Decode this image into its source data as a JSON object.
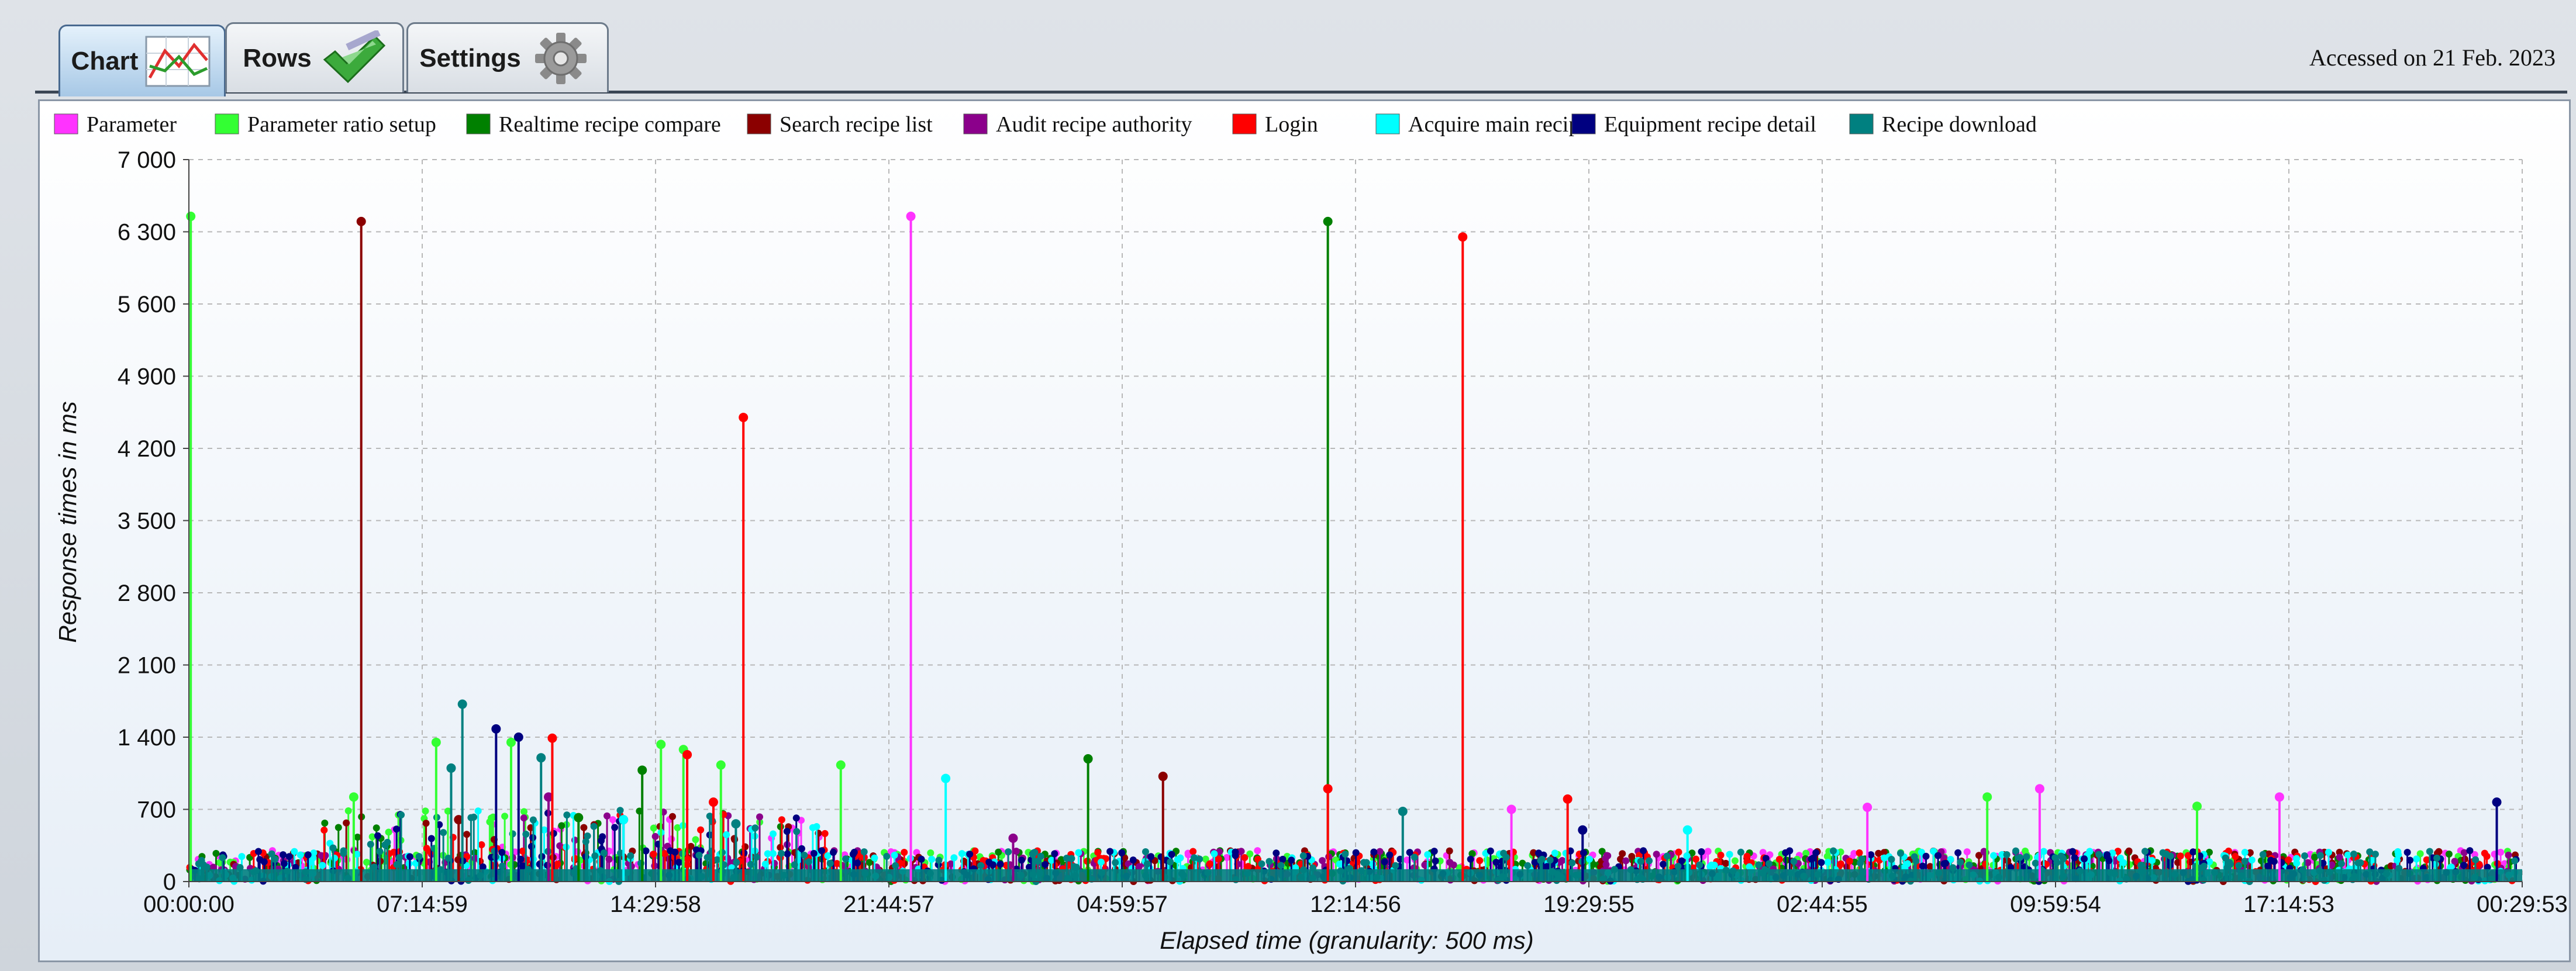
{
  "tabs": [
    {
      "label": "Chart",
      "icon": "line-chart-icon",
      "active": true
    },
    {
      "label": "Rows",
      "icon": "checkmark-icon",
      "active": false
    },
    {
      "label": "Settings",
      "icon": "gear-icon",
      "active": false
    }
  ],
  "accessed_note": "Accessed on 21 Feb. 2023",
  "chart_data": {
    "type": "line",
    "style": "spike/stem plot with point markers",
    "xlabel": "Elapsed time (granularity: 500 ms)",
    "ylabel": "Response times in ms",
    "ylim": [
      0,
      7000
    ],
    "yticks": [
      0,
      700,
      1400,
      2100,
      2800,
      3500,
      4200,
      4900,
      5600,
      6300,
      7000
    ],
    "ytick_labels": [
      "0",
      "700",
      "1 400",
      "2 100",
      "2 800",
      "3 500",
      "4 200",
      "4 900",
      "5 600",
      "6 300",
      "7 000"
    ],
    "xticks": [
      "00:00:00",
      "07:14:59",
      "14:29:58",
      "21:44:57",
      "04:59:57",
      "12:14:56",
      "19:29:55",
      "02:44:55",
      "09:59:54",
      "17:14:53",
      "00:29:53"
    ],
    "xlim_seconds": [
      0,
      311393
    ],
    "grid": true,
    "legend_position": "top",
    "series": [
      {
        "name": "Parameter",
        "color": "#ff33ff",
        "peaks": [
          [
            96350,
            6450
          ],
          [
            247000,
            900
          ],
          [
            224000,
            720
          ],
          [
            176500,
            700
          ],
          [
            279000,
            820
          ]
        ]
      },
      {
        "name": "Parameter ratio setup",
        "color": "#33ff33",
        "peaks": [
          [
            250,
            6450
          ],
          [
            22000,
            820
          ],
          [
            33000,
            1350
          ],
          [
            43000,
            1350
          ],
          [
            63000,
            1330
          ],
          [
            66000,
            1280
          ],
          [
            71000,
            1130
          ],
          [
            87000,
            1130
          ],
          [
            240000,
            820
          ],
          [
            268000,
            730
          ]
        ]
      },
      {
        "name": "Realtime recipe compare",
        "color": "#008000",
        "peaks": [
          [
            152000,
            6400
          ],
          [
            120000,
            1190
          ],
          [
            60500,
            1080
          ],
          [
            52000,
            620
          ]
        ]
      },
      {
        "name": "Search recipe list",
        "color": "#8b0000",
        "peaks": [
          [
            23000,
            6400
          ],
          [
            130000,
            1020
          ],
          [
            36000,
            600
          ]
        ]
      },
      {
        "name": "Audit recipe authority",
        "color": "#8b008b",
        "peaks": [
          [
            48000,
            820
          ],
          [
            58000,
            600
          ],
          [
            110000,
            420
          ]
        ]
      },
      {
        "name": "Login",
        "color": "#ff0000",
        "peaks": [
          [
            74000,
            4500
          ],
          [
            170000,
            6250
          ],
          [
            152000,
            900
          ],
          [
            48500,
            1390
          ],
          [
            66500,
            1230
          ],
          [
            70000,
            770
          ],
          [
            184000,
            800
          ]
        ]
      },
      {
        "name": "Acquire main recipe",
        "color": "#00ffff",
        "peaks": [
          [
            101000,
            1000
          ],
          [
            58000,
            600
          ],
          [
            200000,
            500
          ]
        ]
      },
      {
        "name": "Equipment recipe detail",
        "color": "#000080",
        "peaks": [
          [
            41000,
            1480
          ],
          [
            44000,
            1400
          ],
          [
            308000,
            770
          ],
          [
            186000,
            500
          ]
        ]
      },
      {
        "name": "Recipe download",
        "color": "#008080",
        "peaks": [
          [
            36500,
            1720
          ],
          [
            47000,
            1200
          ],
          [
            35000,
            1100
          ],
          [
            162000,
            680
          ],
          [
            73000,
            560
          ]
        ]
      }
    ],
    "baseline_range_ms": [
      0,
      300
    ]
  }
}
